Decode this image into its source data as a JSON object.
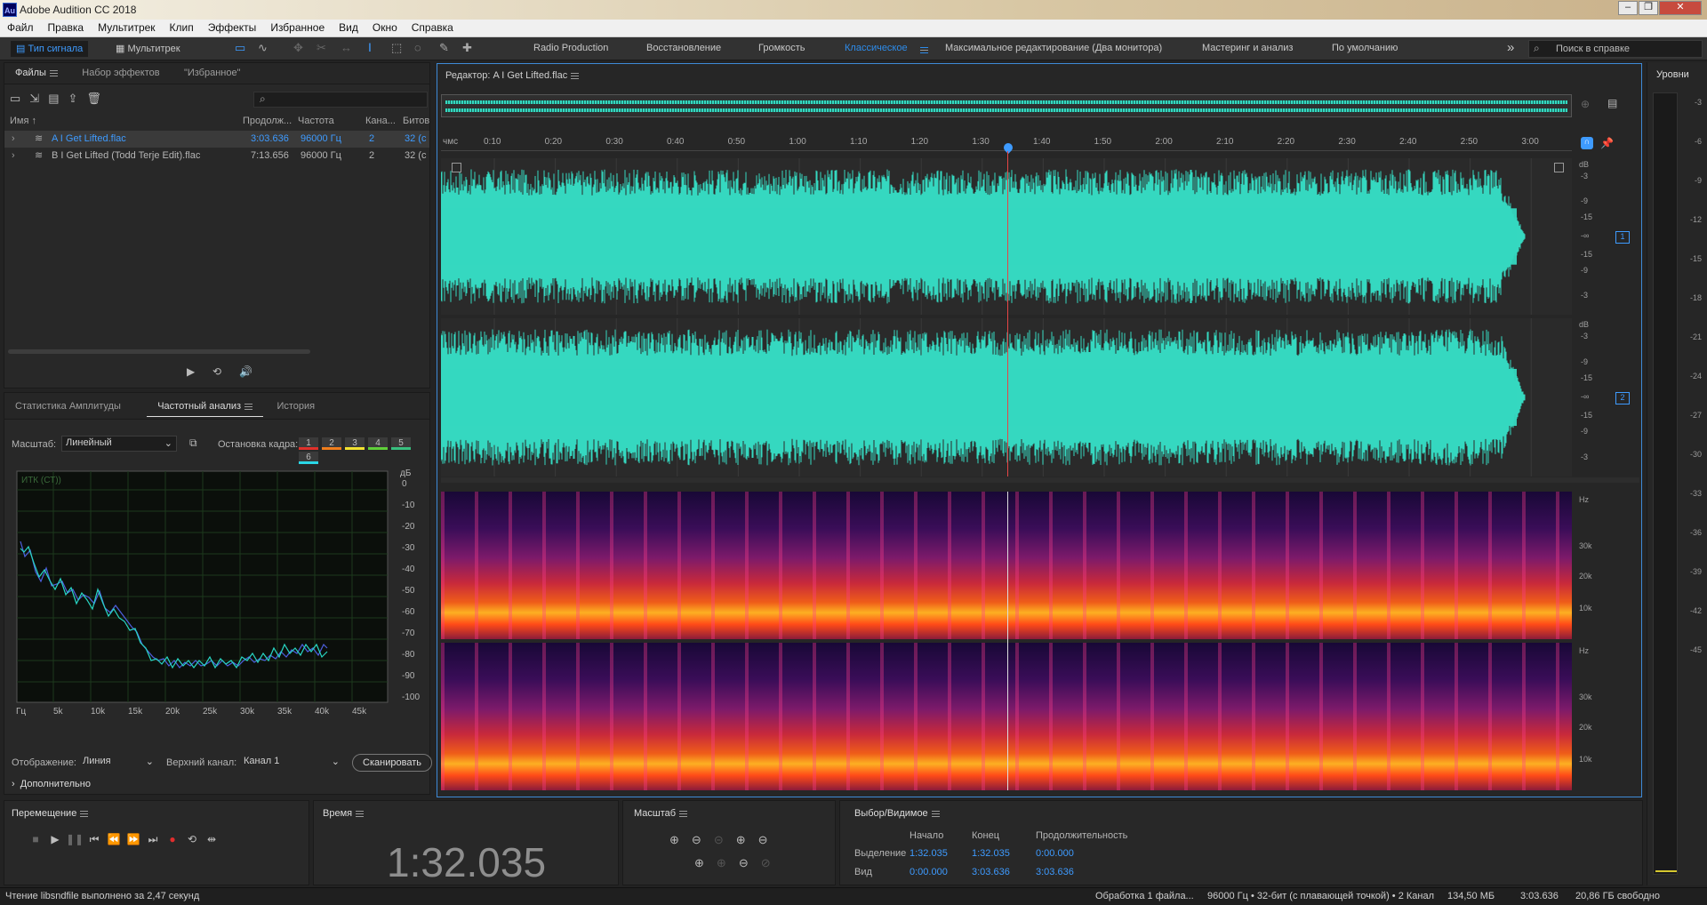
{
  "window": {
    "title": "Adobe Audition CC 2018",
    "logo": "Au"
  },
  "menu": [
    "Файл",
    "Правка",
    "Мультитрек",
    "Клип",
    "Эффекты",
    "Избранное",
    "Вид",
    "Окно",
    "Справка"
  ],
  "toolbar": {
    "waveform_label": "Тип сигнала",
    "multitrack_label": "Мультитрек",
    "workspaces": [
      "Radio Production",
      "Восстановление",
      "Громкость",
      "Классическое",
      "Максимальное редактирование (Два монитора)",
      "Мастеринг и анализ",
      "По умолчанию"
    ],
    "active_workspace": "Классическое",
    "search_placeholder": "Поиск в справке",
    "more": "»"
  },
  "files_panel": {
    "tabs": [
      "Файлы",
      "Набор эффектов",
      "\"Избранное\""
    ],
    "columns": [
      "Имя ↑",
      "Продолж...",
      "Частота",
      "Кана...",
      "Битов"
    ],
    "rows": [
      {
        "name": "A I Get Lifted.flac",
        "duration": "3:03.636",
        "rate": "96000 Гц",
        "channels": "2",
        "bits": "32 (с"
      },
      {
        "name": "B I Get Lifted (Todd Terje Edit).flac",
        "duration": "7:13.656",
        "rate": "96000 Гц",
        "channels": "2",
        "bits": "32 (с"
      }
    ]
  },
  "analysis_panel": {
    "tabs": [
      "Статистика Амплитуды",
      "Частотный анализ",
      "История"
    ],
    "scale_label": "Масштаб:",
    "scale_value": "Линейный",
    "freeze_label": "Остановка кадра:",
    "freeze_buttons": [
      "1",
      "2",
      "3",
      "4",
      "5",
      "6"
    ],
    "freeze_colors": [
      "#e0302a",
      "#f07d1c",
      "#f2e230",
      "#5fd03a",
      "#38c07f",
      "#2ad6e6"
    ],
    "graph_title": "ИТК (СТ))",
    "db_unit": "дБ",
    "db_ticks": [
      "0",
      "-10",
      "-20",
      "-30",
      "-40",
      "-50",
      "-60",
      "-70",
      "-80",
      "-90",
      "-100"
    ],
    "freq_ticks": [
      "Гц",
      "5k",
      "10k",
      "15k",
      "20k",
      "25k",
      "30k",
      "35k",
      "40k",
      "45k"
    ],
    "display_label": "Отображение:",
    "display_value": "Линия",
    "channel_label": "Верхний канал:",
    "channel_value": "Канал 1",
    "scan_button": "Сканировать",
    "advanced": "Дополнительно"
  },
  "editor": {
    "title": "Редактор: A I Get Lifted.flac",
    "ruler_unit": "чмс",
    "ruler_ticks": [
      "0:10",
      "0:20",
      "0:30",
      "0:40",
      "0:50",
      "1:00",
      "1:10",
      "1:20",
      "1:30",
      "1:40",
      "1:50",
      "2:00",
      "2:10",
      "2:20",
      "2:30",
      "2:40",
      "2:50",
      "3:00"
    ],
    "db_label": "dB",
    "db_scale": [
      "-3",
      "-9",
      "-15",
      "-∞",
      "-15",
      "-9",
      "-3"
    ],
    "channel_badges": [
      "1",
      "2"
    ],
    "hz_label": "Hz",
    "hz_ticks": [
      "30k",
      "20k",
      "10k"
    ],
    "playhead_time_fraction": 0.5015,
    "waveform_color": "#35d8c0"
  },
  "levels": {
    "title": "Уровни",
    "ticks": [
      "-3",
      "-6",
      "-9",
      "-12",
      "-15",
      "-18",
      "-21",
      "-24",
      "-27",
      "-30",
      "-33",
      "-36",
      "-39",
      "-42",
      "-45"
    ]
  },
  "transport": {
    "title": "Перемещение",
    "buttons": [
      "stop-icon",
      "play-icon",
      "pause-icon",
      "rewind-start-icon",
      "rewind-icon",
      "fast-forward-icon",
      "forward-end-icon",
      "record-icon",
      "loop-icon",
      "skip-icon"
    ]
  },
  "time": {
    "title": "Время",
    "value": "1:32.035"
  },
  "zoom": {
    "title": "Масштаб"
  },
  "selection": {
    "title": "Выбор/Видимое",
    "headers": [
      "Начало",
      "Конец",
      "Продолжительность"
    ],
    "rows": [
      {
        "label": "Выделение",
        "start": "1:32.035",
        "end": "1:32.035",
        "duration": "0:00.000"
      },
      {
        "label": "Вид",
        "start": "0:00.000",
        "end": "3:03.636",
        "duration": "3:03.636"
      }
    ]
  },
  "status": {
    "left": "Чтение libsndfile выполнено за 2,47 секунд",
    "processing": "Обработка 1 файла...",
    "format": "96000 Гц • 32-бит (с плавающей точкой) • 2 Канал",
    "size": "134,50 МБ",
    "duration": "3:03.636",
    "free": "20,86 ГБ свободно"
  }
}
